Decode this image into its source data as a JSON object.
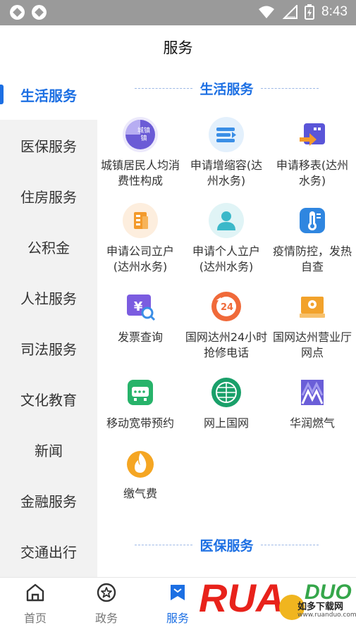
{
  "status_bar": {
    "time": "8:43"
  },
  "header": {
    "title": "服务"
  },
  "sidebar": {
    "items": [
      {
        "label": "生活服务",
        "active": true
      },
      {
        "label": "医保服务"
      },
      {
        "label": "住房服务"
      },
      {
        "label": "公积金"
      },
      {
        "label": "人社服务"
      },
      {
        "label": "司法服务"
      },
      {
        "label": "文化教育"
      },
      {
        "label": "新闻"
      },
      {
        "label": "金融服务"
      },
      {
        "label": "交通出行"
      }
    ]
  },
  "sections": [
    {
      "title": "生活服务",
      "items": [
        {
          "label": "城镇居民人均消费性构成",
          "icon": "urban-pie-icon",
          "icon_text": "城镇",
          "color": "#6b5bd6"
        },
        {
          "label": "申请增缩容(达州水务)",
          "icon": "capacity-icon",
          "color": "#3a8ee6"
        },
        {
          "label": "申请移表(达州水务)",
          "icon": "move-meter-icon",
          "color": "#5a55d8"
        },
        {
          "label": "申请公司立户(达州水务)",
          "icon": "company-account-icon",
          "color": "#f39a2b"
        },
        {
          "label": "申请个人立户(达州水务)",
          "icon": "personal-account-icon",
          "color": "#3bb8c9"
        },
        {
          "label": "疫情防控，发热自查",
          "icon": "thermometer-icon",
          "color": "#2f86e0"
        },
        {
          "label": "发票查询",
          "icon": "invoice-search-icon",
          "icon_text": "¥",
          "color": "#7b5ce0"
        },
        {
          "label": "国网达州24小时抢修电话",
          "icon": "repair-24-icon",
          "icon_text": "24",
          "color": "#f06a3a"
        },
        {
          "label": "国网达州营业厅网点",
          "icon": "outlet-location-icon",
          "color": "#f2a22b"
        },
        {
          "label": "移动宽带预约",
          "icon": "router-icon",
          "color": "#27b36a"
        },
        {
          "label": "网上国网",
          "icon": "state-grid-icon",
          "color": "#1aa06a"
        },
        {
          "label": "华润燃气",
          "icon": "cr-gas-icon",
          "color": "#6a5ed8"
        },
        {
          "label": "缴气费",
          "icon": "flame-icon",
          "color": "#f5a623"
        }
      ]
    },
    {
      "title": "医保服务",
      "items": []
    }
  ],
  "bottom_nav": {
    "items": [
      {
        "label": "首页",
        "icon": "home-icon"
      },
      {
        "label": "政务",
        "icon": "star-badge-icon"
      },
      {
        "label": "服务",
        "icon": "service-bookmark-icon",
        "active": true
      }
    ]
  },
  "watermark": {
    "brand": "RUANDUO",
    "cn": "如多下载网",
    "url": "www.ruanduo.com"
  }
}
